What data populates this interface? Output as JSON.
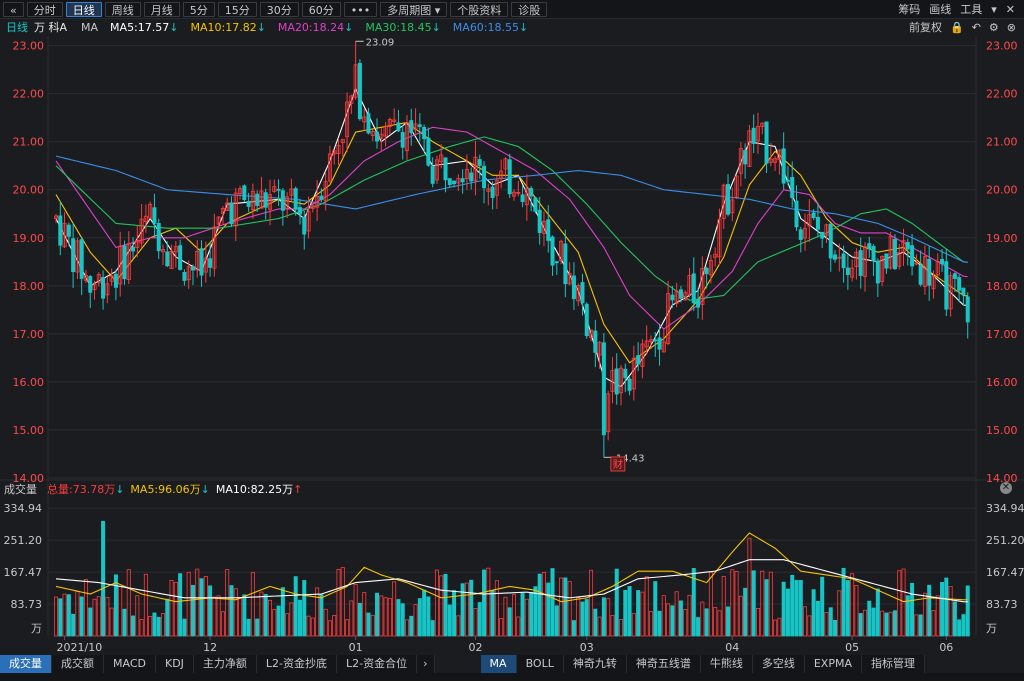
{
  "toolbar": {
    "items": [
      "分时",
      "日线",
      "周线",
      "月线",
      "5分",
      "15分",
      "30分",
      "60分",
      "•••",
      "多周期图 ▾",
      "个股资料",
      "诊股"
    ],
    "active": "日线",
    "right": [
      "筹码",
      "画线",
      "工具"
    ]
  },
  "legend": {
    "period": "日线",
    "stock": "万 科A",
    "ma_label": "MA",
    "ma5": "MA5:17.57",
    "ma10": "MA10:17.82",
    "ma20": "MA20:18.24",
    "ma30": "MA30:18.45",
    "ma60": "MA60:18.55",
    "right": "前复权"
  },
  "vol_legend": {
    "title": "成交量",
    "total": "总量:73.78万",
    "ma5": "MA5:96.06万",
    "ma10": "MA10:82.25万"
  },
  "bottom_tabs_left": [
    "成交量",
    "成交额",
    "MACD",
    "KDJ",
    "主力净额",
    "L2-资金抄底",
    "L2-资金合位"
  ],
  "bottom_tabs_right": [
    "MA",
    "BOLL",
    "神奇九转",
    "神奇五线谱",
    "牛熊线",
    "多空线",
    "EXPMA",
    "指标管理"
  ],
  "colors": {
    "up": "#ff3b3b",
    "down": "#16c6c6",
    "ma5": "#ffffff",
    "ma10": "#f5c400",
    "ma20": "#e040c8",
    "ma30": "#22c55e",
    "ma60": "#3a8ee8"
  },
  "chart_data": {
    "type": "candlestick",
    "y_ticks": [
      "23.00",
      "22.00",
      "21.00",
      "20.00",
      "19.00",
      "18.00",
      "17.00",
      "16.00",
      "15.00",
      "14.00"
    ],
    "ylim": [
      14.0,
      23.2
    ],
    "x_labels": [
      "2021/10",
      "12",
      "01",
      "02",
      "03",
      "04",
      "05",
      "06"
    ],
    "annotations": {
      "high": "23.09",
      "low": "14.43",
      "event": "财"
    },
    "vol_ticks": [
      "334.94",
      "251.20",
      "167.47",
      "83.73",
      "万"
    ],
    "vol_max": 334.94,
    "ma_anchors": {
      "ma5": [
        [
          0,
          19.4
        ],
        [
          8,
          18.0
        ],
        [
          14,
          18.3
        ],
        [
          22,
          19.4
        ],
        [
          28,
          18.6
        ],
        [
          34,
          18.3
        ],
        [
          40,
          19.7
        ],
        [
          52,
          19.8
        ],
        [
          58,
          19.4
        ],
        [
          64,
          20.6
        ],
        [
          70,
          22.1
        ],
        [
          76,
          21.0
        ],
        [
          82,
          21.4
        ],
        [
          88,
          20.5
        ],
        [
          96,
          20.6
        ],
        [
          102,
          20.1
        ],
        [
          108,
          20.3
        ],
        [
          114,
          19.2
        ],
        [
          122,
          17.9
        ],
        [
          128,
          16.1
        ],
        [
          132,
          15.9
        ],
        [
          138,
          16.6
        ],
        [
          144,
          17.6
        ],
        [
          150,
          17.9
        ],
        [
          156,
          19.7
        ],
        [
          162,
          21.0
        ],
        [
          168,
          20.9
        ],
        [
          174,
          19.4
        ],
        [
          180,
          19.0
        ],
        [
          186,
          18.6
        ],
        [
          192,
          18.5
        ],
        [
          198,
          18.7
        ],
        [
          204,
          18.3
        ],
        [
          212,
          17.6
        ]
      ],
      "ma10": [
        [
          0,
          19.9
        ],
        [
          8,
          18.7
        ],
        [
          14,
          18.1
        ],
        [
          22,
          19.0
        ],
        [
          28,
          19.2
        ],
        [
          34,
          18.7
        ],
        [
          40,
          19.3
        ],
        [
          52,
          19.8
        ],
        [
          58,
          19.7
        ],
        [
          64,
          20.1
        ],
        [
          70,
          21.2
        ],
        [
          76,
          21.3
        ],
        [
          82,
          21.4
        ],
        [
          88,
          21.0
        ],
        [
          96,
          20.6
        ],
        [
          102,
          20.3
        ],
        [
          108,
          20.3
        ],
        [
          114,
          19.6
        ],
        [
          122,
          18.7
        ],
        [
          128,
          17.2
        ],
        [
          134,
          16.4
        ],
        [
          142,
          16.9
        ],
        [
          150,
          17.7
        ],
        [
          156,
          18.6
        ],
        [
          162,
          20.1
        ],
        [
          168,
          20.8
        ],
        [
          174,
          20.3
        ],
        [
          180,
          19.4
        ],
        [
          186,
          18.9
        ],
        [
          192,
          18.7
        ],
        [
          198,
          18.8
        ],
        [
          204,
          18.3
        ],
        [
          212,
          17.8
        ]
      ],
      "ma20": [
        [
          0,
          20.6
        ],
        [
          14,
          18.8
        ],
        [
          22,
          19.0
        ],
        [
          30,
          19.0
        ],
        [
          40,
          19.3
        ],
        [
          52,
          19.6
        ],
        [
          58,
          19.6
        ],
        [
          64,
          19.9
        ],
        [
          72,
          20.6
        ],
        [
          80,
          21.0
        ],
        [
          88,
          21.3
        ],
        [
          96,
          21.2
        ],
        [
          104,
          20.8
        ],
        [
          112,
          20.4
        ],
        [
          120,
          19.8
        ],
        [
          128,
          18.8
        ],
        [
          134,
          17.8
        ],
        [
          142,
          17.1
        ],
        [
          150,
          17.6
        ],
        [
          158,
          18.3
        ],
        [
          164,
          19.3
        ],
        [
          170,
          20.0
        ],
        [
          176,
          19.9
        ],
        [
          182,
          19.3
        ],
        [
          188,
          19.1
        ],
        [
          194,
          19.1
        ],
        [
          200,
          18.8
        ],
        [
          206,
          18.5
        ],
        [
          212,
          18.2
        ]
      ],
      "ma30": [
        [
          0,
          20.5
        ],
        [
          14,
          19.3
        ],
        [
          26,
          19.2
        ],
        [
          38,
          19.2
        ],
        [
          52,
          19.4
        ],
        [
          62,
          19.7
        ],
        [
          72,
          20.2
        ],
        [
          82,
          20.6
        ],
        [
          92,
          20.9
        ],
        [
          100,
          21.1
        ],
        [
          108,
          20.9
        ],
        [
          116,
          20.4
        ],
        [
          124,
          19.7
        ],
        [
          132,
          18.9
        ],
        [
          140,
          18.2
        ],
        [
          148,
          17.7
        ],
        [
          156,
          17.8
        ],
        [
          164,
          18.5
        ],
        [
          172,
          18.8
        ],
        [
          180,
          19.1
        ],
        [
          188,
          19.5
        ],
        [
          194,
          19.6
        ],
        [
          200,
          19.3
        ],
        [
          206,
          18.9
        ],
        [
          212,
          18.5
        ]
      ],
      "ma60": [
        [
          0,
          20.7
        ],
        [
          14,
          20.4
        ],
        [
          26,
          20.0
        ],
        [
          40,
          19.9
        ],
        [
          56,
          19.8
        ],
        [
          70,
          19.6
        ],
        [
          84,
          19.9
        ],
        [
          100,
          20.2
        ],
        [
          112,
          20.3
        ],
        [
          122,
          20.4
        ],
        [
          132,
          20.3
        ],
        [
          142,
          20.0
        ],
        [
          152,
          19.9
        ],
        [
          162,
          19.8
        ],
        [
          172,
          19.6
        ],
        [
          182,
          19.5
        ],
        [
          192,
          19.3
        ],
        [
          200,
          19.0
        ],
        [
          212,
          18.5
        ]
      ]
    },
    "vol_ma_anchors": {
      "ma5": [
        [
          0,
          130
        ],
        [
          8,
          110
        ],
        [
          14,
          140
        ],
        [
          20,
          110
        ],
        [
          28,
          90
        ],
        [
          36,
          100
        ],
        [
          42,
          95
        ],
        [
          50,
          130
        ],
        [
          56,
          110
        ],
        [
          62,
          100
        ],
        [
          68,
          130
        ],
        [
          72,
          180
        ],
        [
          76,
          160
        ],
        [
          82,
          140
        ],
        [
          90,
          100
        ],
        [
          98,
          110
        ],
        [
          106,
          130
        ],
        [
          112,
          120
        ],
        [
          118,
          90
        ],
        [
          124,
          100
        ],
        [
          130,
          130
        ],
        [
          136,
          170
        ],
        [
          144,
          170
        ],
        [
          152,
          140
        ],
        [
          158,
          220
        ],
        [
          162,
          270
        ],
        [
          168,
          230
        ],
        [
          174,
          170
        ],
        [
          180,
          160
        ],
        [
          186,
          150
        ],
        [
          192,
          120
        ],
        [
          198,
          90
        ],
        [
          204,
          100
        ],
        [
          212,
          95
        ]
      ],
      "ma10": [
        [
          0,
          150
        ],
        [
          10,
          140
        ],
        [
          20,
          120
        ],
        [
          30,
          100
        ],
        [
          42,
          100
        ],
        [
          52,
          105
        ],
        [
          62,
          110
        ],
        [
          70,
          140
        ],
        [
          80,
          150
        ],
        [
          90,
          120
        ],
        [
          100,
          110
        ],
        [
          110,
          115
        ],
        [
          120,
          100
        ],
        [
          128,
          110
        ],
        [
          136,
          150
        ],
        [
          146,
          160
        ],
        [
          154,
          170
        ],
        [
          162,
          200
        ],
        [
          170,
          200
        ],
        [
          180,
          170
        ],
        [
          190,
          140
        ],
        [
          200,
          110
        ],
        [
          212,
          90
        ]
      ]
    }
  }
}
